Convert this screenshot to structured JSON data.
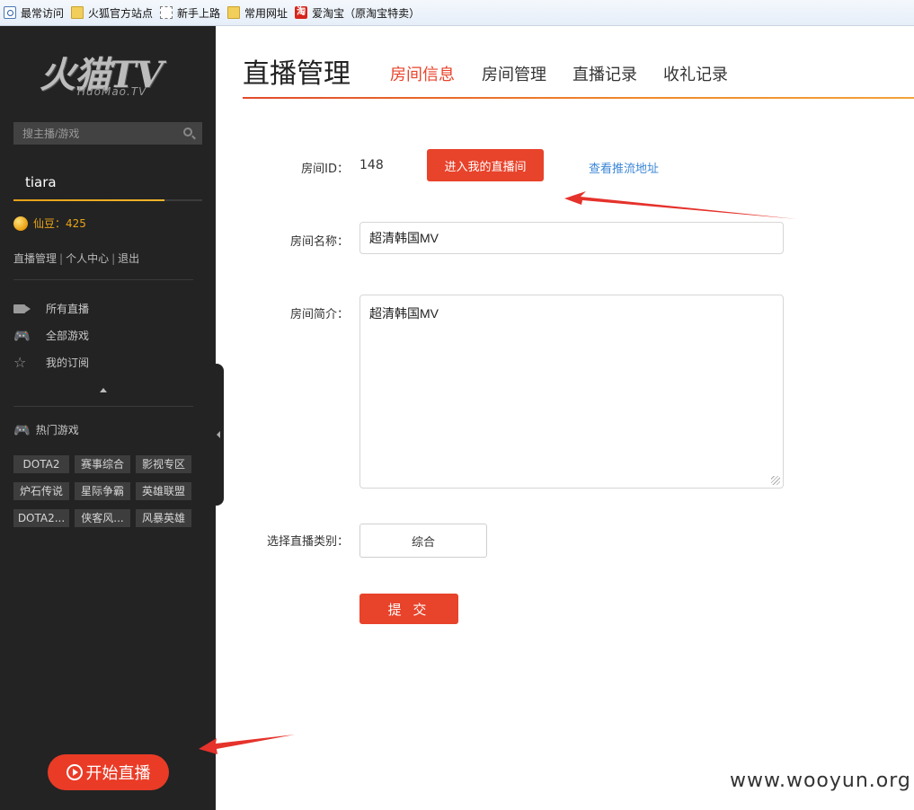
{
  "bookmarks": [
    {
      "label": "最常访问",
      "icon": "most-visited-icon"
    },
    {
      "label": "火狐官方站点",
      "icon": "folder-icon"
    },
    {
      "label": "新手上路",
      "icon": "dashed-page-icon"
    },
    {
      "label": "常用网址",
      "icon": "folder-icon"
    },
    {
      "label": "爱淘宝（原淘宝特卖）",
      "icon": "taobao-icon",
      "icon_glyph": "淘"
    }
  ],
  "sidebar": {
    "logo": {
      "main": "火猫TV",
      "sub": "HuoMao.TV"
    },
    "search": {
      "placeholder": "搜主播/游戏",
      "value": ""
    },
    "username": "tiara",
    "coins_label": "仙豆：425",
    "user_links": [
      "直播管理",
      "个人中心",
      "退出"
    ],
    "link_separator": "|",
    "nav": [
      {
        "label": "所有直播",
        "icon": "video-camera-icon"
      },
      {
        "label": "全部游戏",
        "icon": "gamepad-icon"
      },
      {
        "label": "我的订阅",
        "icon": "star-icon"
      }
    ],
    "hot_games_title": "热门游戏",
    "hot_games": [
      "DOTA2",
      "赛事综合",
      "影视专区",
      "炉石传说",
      "星际争霸",
      "英雄联盟",
      "DOTA2...",
      "侠客风...",
      "风暴英雄"
    ],
    "start_live_label": "开始直播"
  },
  "main": {
    "title": "直播管理",
    "tabs": [
      {
        "label": "房间信息",
        "active": true
      },
      {
        "label": "房间管理",
        "active": false
      },
      {
        "label": "直播记录",
        "active": false
      },
      {
        "label": "收礼记录",
        "active": false
      }
    ],
    "form": {
      "room_id_label": "房间ID：",
      "room_id_value": "148",
      "enter_room_label": "进入我的直播间",
      "push_url_label": "查看推流地址",
      "room_name_label": "房间名称：",
      "room_name_value": "超清韩国MV",
      "room_intro_label": "房间简介：",
      "room_intro_value": "超清韩国MV",
      "category_label": "选择直播类别：",
      "category_value": "综合",
      "submit_label": "提 交"
    }
  },
  "watermark": "www.wooyun.org",
  "colors": {
    "accent": "#e8432b",
    "sidebar_bg": "#232323",
    "link": "#3b86d6",
    "coins": "#e8a317"
  }
}
